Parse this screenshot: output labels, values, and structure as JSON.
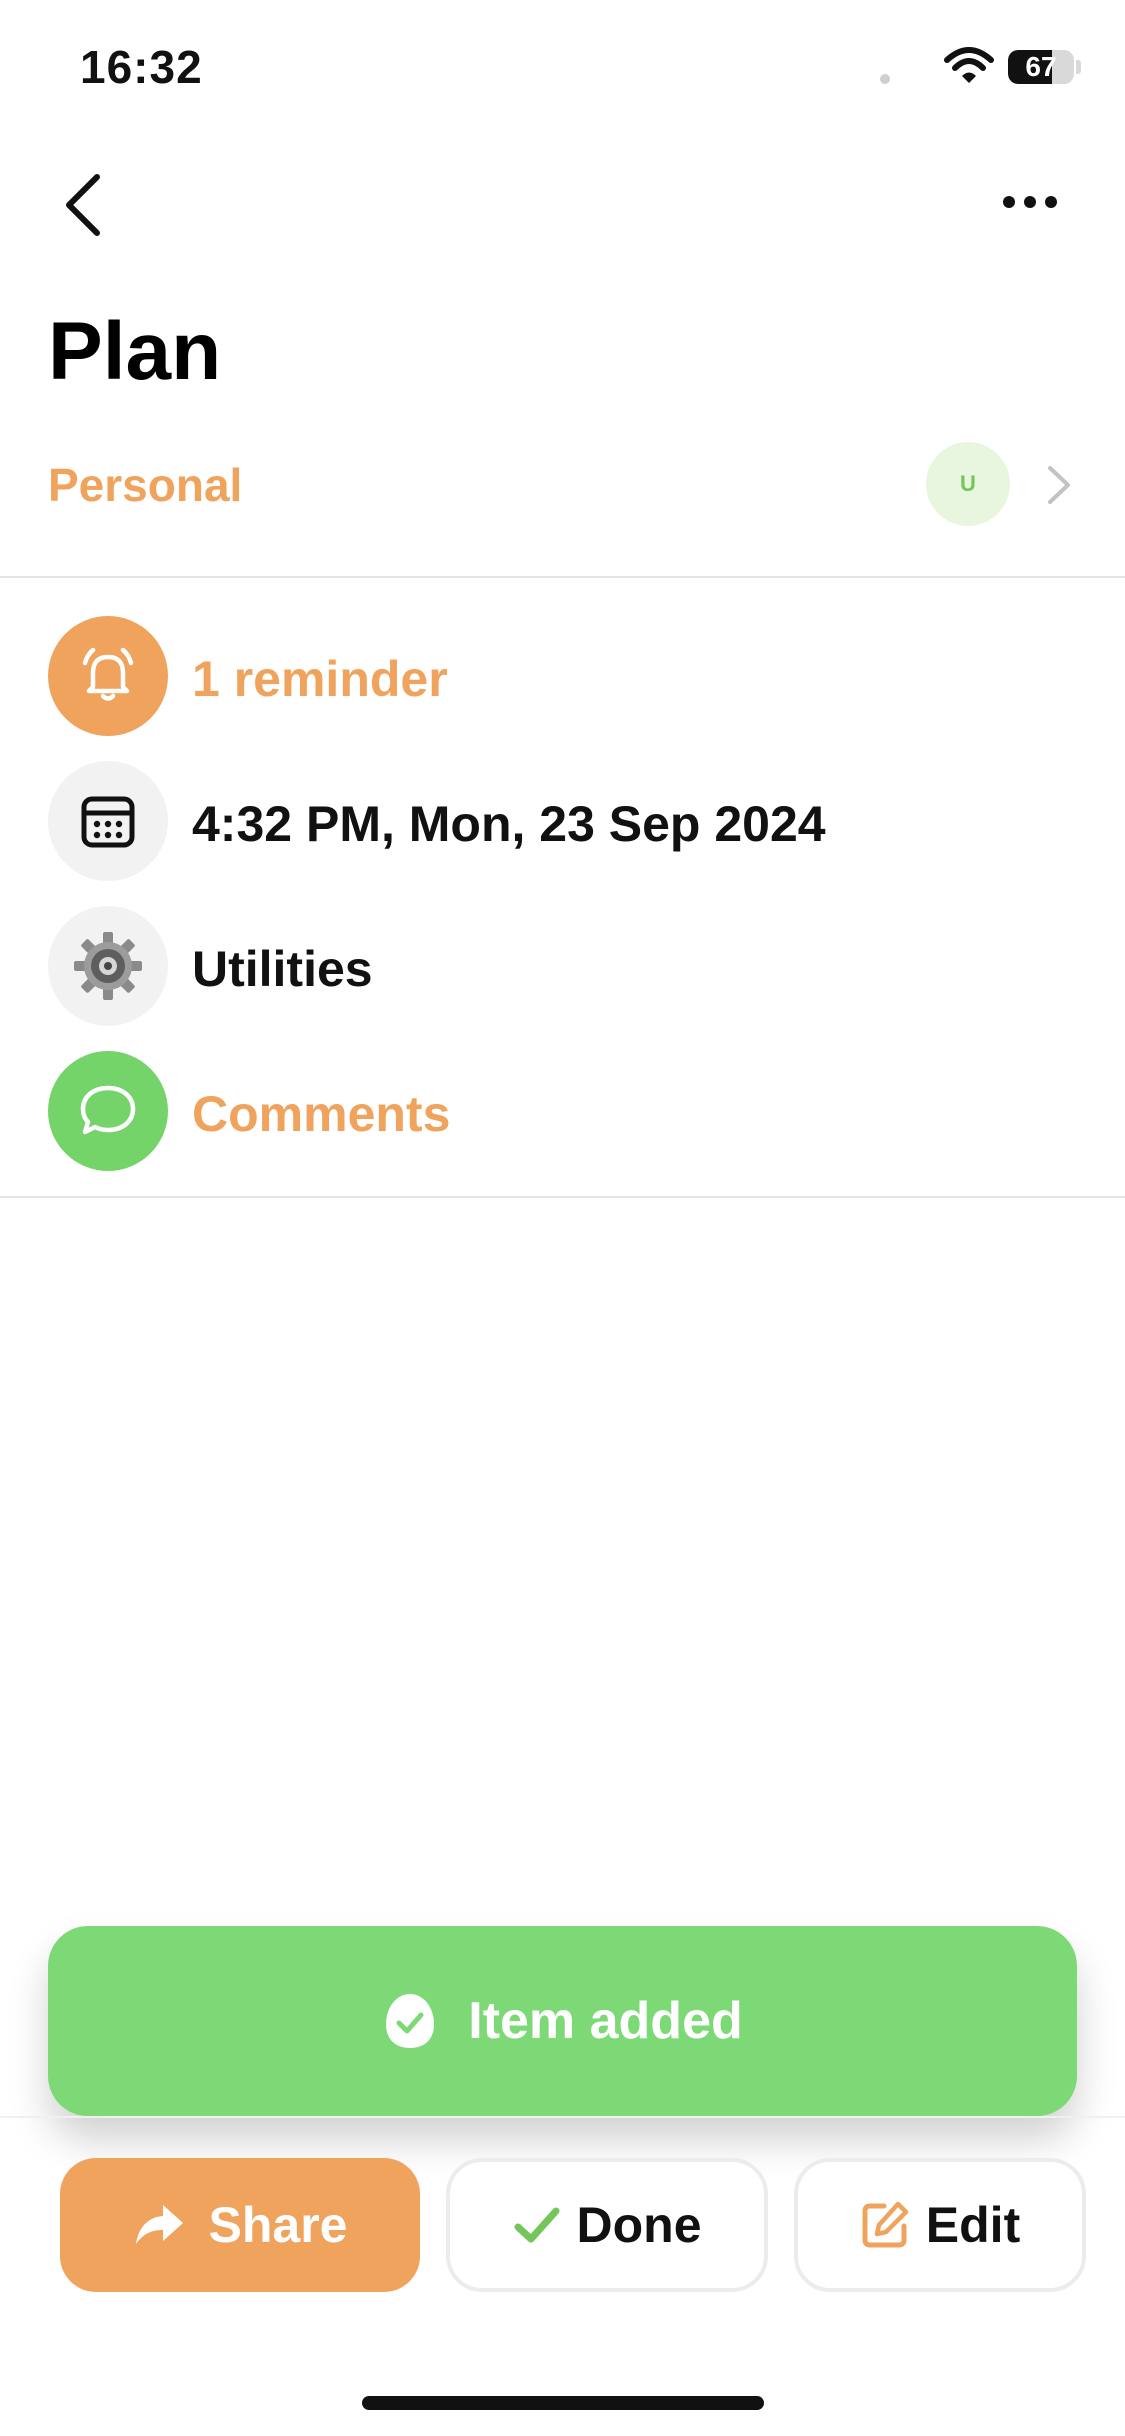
{
  "status_bar": {
    "time": "16:32",
    "battery_level": "67",
    "battery_fraction": 0.67
  },
  "header": {
    "title": "Plan",
    "back_icon": "chevron-left-icon",
    "more_icon": "more-horizontal-icon"
  },
  "list": {
    "label": "Personal",
    "avatar_initial": "U",
    "avatar_color": "#74c65b",
    "avatar_bg": "#e8f6df"
  },
  "details": {
    "reminder": {
      "text": "1 reminder",
      "icon": "bell-icon",
      "icon_bg": "#f0a35c"
    },
    "date": {
      "text": "4:32 PM, Mon, 23 Sep 2024",
      "icon": "calendar-icon",
      "icon_bg": "#f2f2f2"
    },
    "category": {
      "text": "Utilities",
      "icon": "gear-icon",
      "icon_bg": "#f2f2f2"
    },
    "comments": {
      "text": "Comments",
      "icon": "chat-bubble-icon",
      "icon_bg": "#74d46a"
    }
  },
  "toast": {
    "text": "Item added",
    "icon": "check-circle-icon",
    "bg": "#7dd975"
  },
  "actions": {
    "share_label": "Share",
    "done_label": "Done",
    "edit_label": "Edit"
  },
  "colors": {
    "accent": "#f0a35c",
    "success": "#74c65b"
  }
}
